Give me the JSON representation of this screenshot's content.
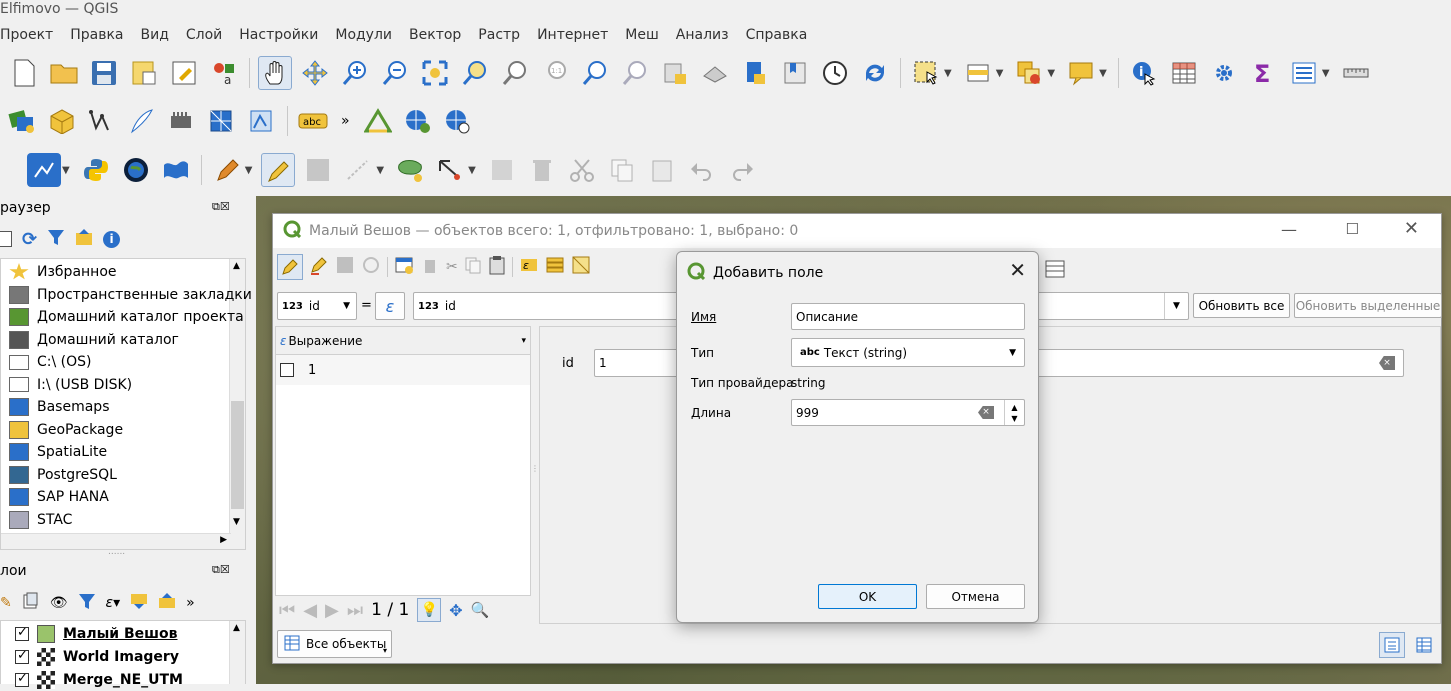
{
  "window_title": "Elfimovo — QGIS",
  "menu": [
    "Проект",
    "Правка",
    "Вид",
    "Слой",
    "Настройки",
    "Модули",
    "Вектор",
    "Растр",
    "Интернет",
    "Меш",
    "Анализ",
    "Справка"
  ],
  "browser": {
    "title": "раузер",
    "items": [
      {
        "label": "Избранное",
        "icon": "star-icon"
      },
      {
        "label": "Пространственные закладки",
        "icon": "bookmark-icon"
      },
      {
        "label": "Домашний каталог проекта",
        "icon": "project-home-icon"
      },
      {
        "label": "Домашний каталог",
        "icon": "home-icon"
      },
      {
        "label": "C:\\ (OS)",
        "icon": "folder-icon"
      },
      {
        "label": "I:\\ (USB DISK)",
        "icon": "folder-icon"
      },
      {
        "label": "Basemaps",
        "icon": "basemaps-icon"
      },
      {
        "label": "GeoPackage",
        "icon": "geopackage-icon"
      },
      {
        "label": "SpatiaLite",
        "icon": "spatialite-icon"
      },
      {
        "label": "PostgreSQL",
        "icon": "postgresql-icon"
      },
      {
        "label": "SAP HANA",
        "icon": "saphana-icon"
      },
      {
        "label": "STAC",
        "icon": "stac-icon"
      }
    ]
  },
  "layers": {
    "title": "лои",
    "items": [
      {
        "label": "Малый Вешов",
        "checked": true,
        "underline": true
      },
      {
        "label": "World Imagery",
        "checked": true
      },
      {
        "label": "Merge_NE_UTM",
        "checked": true
      }
    ]
  },
  "attr_table": {
    "title": "Малый Вешов — объектов всего: 1, отфильтровано: 1, выбрано: 0",
    "field_select": "id",
    "field_badge": "123",
    "equals": "=",
    "expr_value": "id",
    "update_all": "Обновить все",
    "update_selected": "Обновить выделенные",
    "expression_header": "Выражение",
    "row_value": "1",
    "form_label": "id",
    "form_value": "1",
    "pager": "1 / 1",
    "filter_button": "Все объекты"
  },
  "dialog": {
    "title": "Добавить поле",
    "name_label": "Имя",
    "name_value": "Описание",
    "type_label": "Тип",
    "type_badge": "abc",
    "type_value": "Текст (string)",
    "provider_label": "Тип провайдера",
    "provider_value": "string",
    "length_label": "Длина",
    "length_value": "999",
    "ok": "OK",
    "cancel": "Отмена"
  },
  "colors": {
    "accent": "#2a6fc9",
    "qgis_green": "#589632",
    "button_focus": "#cce4f7"
  }
}
